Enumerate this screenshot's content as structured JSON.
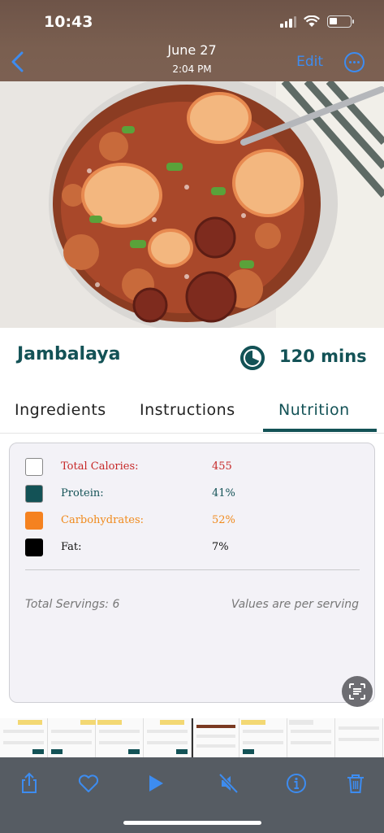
{
  "status": {
    "time": "10:43"
  },
  "nav": {
    "date": "June 27",
    "time": "2:04 PM",
    "edit_label": "Edit"
  },
  "recipe": {
    "title": "Jambalaya",
    "cook_time": "120 mins"
  },
  "tabs": [
    {
      "label": "Ingredients",
      "active": false
    },
    {
      "label": "Instructions",
      "active": false
    },
    {
      "label": "Nutrition",
      "active": true
    }
  ],
  "nutrition": {
    "rows": [
      {
        "label": "Total Calories:",
        "value": "455",
        "color": "#c62828",
        "swatch": "#ffffff"
      },
      {
        "label": "Protein:",
        "value": "41%",
        "color": "#135256",
        "swatch": "#135256"
      },
      {
        "label": "Carbohydrates:",
        "value": "52%",
        "color": "#f08a1c",
        "swatch": "#f58220"
      },
      {
        "label": "Fat:",
        "value": "7%",
        "color": "#111111",
        "swatch": "#000000"
      }
    ],
    "servings": "Total Servings: 6",
    "per_serving": "Values are per serving"
  },
  "colors": {
    "brand": "#135256",
    "ios_blue": "#3d8cf0"
  },
  "toolbar_icons": [
    "share-icon",
    "heart-icon",
    "play-icon",
    "mute-icon",
    "info-icon",
    "trash-icon"
  ]
}
